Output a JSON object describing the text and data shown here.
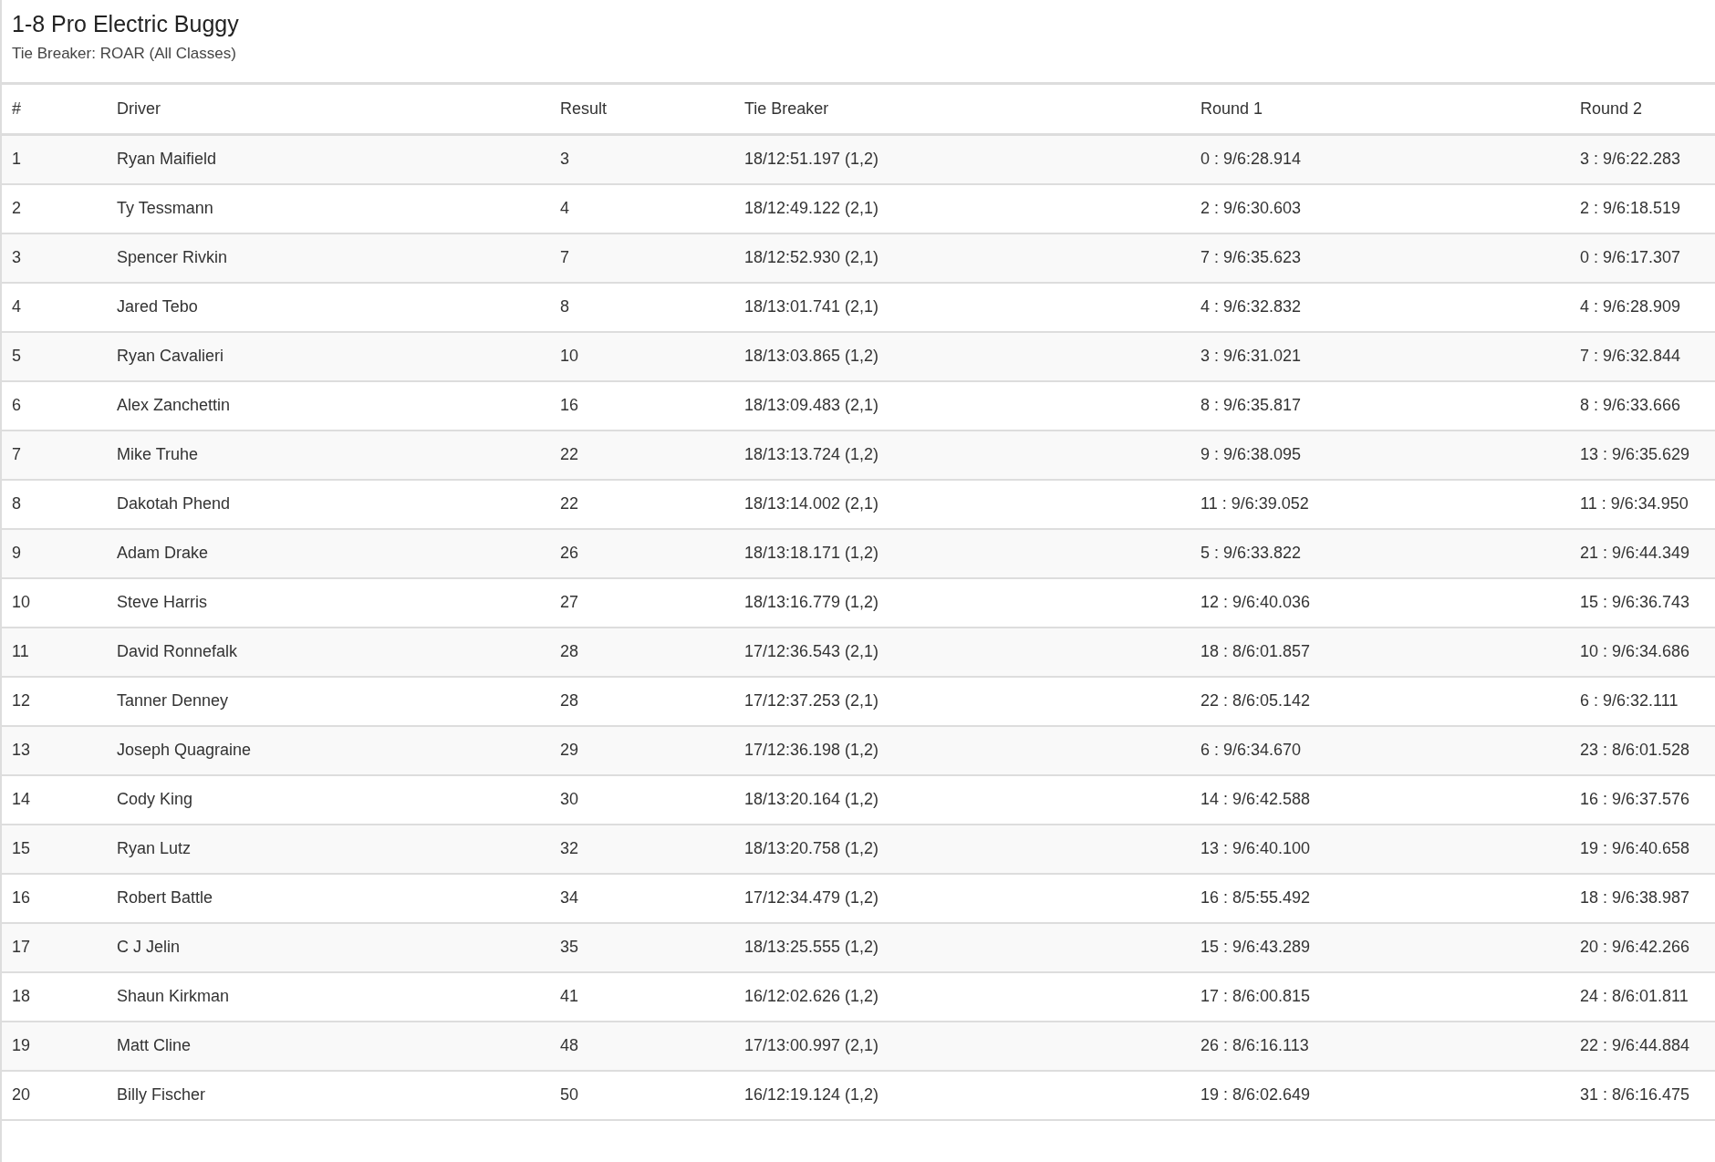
{
  "heading": {
    "title": "1-8 Pro Electric Buggy",
    "subtitle": "Tie Breaker: ROAR (All Classes)"
  },
  "table": {
    "columns": [
      "#",
      "Driver",
      "Result",
      "Tie Breaker",
      "Round 1",
      "Round 2"
    ],
    "rows": [
      [
        "1",
        "Ryan Maifield",
        "3",
        "18/12:51.197 (1,2)",
        "0 : 9/6:28.914",
        "3 : 9/6:22.283"
      ],
      [
        "2",
        "Ty Tessmann",
        "4",
        "18/12:49.122 (2,1)",
        "2 : 9/6:30.603",
        "2 : 9/6:18.519"
      ],
      [
        "3",
        "Spencer Rivkin",
        "7",
        "18/12:52.930 (2,1)",
        "7 : 9/6:35.623",
        "0 : 9/6:17.307"
      ],
      [
        "4",
        "Jared Tebo",
        "8",
        "18/13:01.741 (2,1)",
        "4 : 9/6:32.832",
        "4 : 9/6:28.909"
      ],
      [
        "5",
        "Ryan Cavalieri",
        "10",
        "18/13:03.865 (1,2)",
        "3 : 9/6:31.021",
        "7 : 9/6:32.844"
      ],
      [
        "6",
        "Alex Zanchettin",
        "16",
        "18/13:09.483 (2,1)",
        "8 : 9/6:35.817",
        "8 : 9/6:33.666"
      ],
      [
        "7",
        "Mike Truhe",
        "22",
        "18/13:13.724 (1,2)",
        "9 : 9/6:38.095",
        "13 : 9/6:35.629"
      ],
      [
        "8",
        "Dakotah Phend",
        "22",
        "18/13:14.002 (2,1)",
        "11 : 9/6:39.052",
        "11 : 9/6:34.950"
      ],
      [
        "9",
        "Adam Drake",
        "26",
        "18/13:18.171 (1,2)",
        "5 : 9/6:33.822",
        "21 : 9/6:44.349"
      ],
      [
        "10",
        "Steve Harris",
        "27",
        "18/13:16.779 (1,2)",
        "12 : 9/6:40.036",
        "15 : 9/6:36.743"
      ],
      [
        "11",
        "David Ronnefalk",
        "28",
        "17/12:36.543 (2,1)",
        "18 : 8/6:01.857",
        "10 : 9/6:34.686"
      ],
      [
        "12",
        "Tanner Denney",
        "28",
        "17/12:37.253 (2,1)",
        "22 : 8/6:05.142",
        "6 : 9/6:32.111"
      ],
      [
        "13",
        "Joseph Quagraine",
        "29",
        "17/12:36.198 (1,2)",
        "6 : 9/6:34.670",
        "23 : 8/6:01.528"
      ],
      [
        "14",
        "Cody King",
        "30",
        "18/13:20.164 (1,2)",
        "14 : 9/6:42.588",
        "16 : 9/6:37.576"
      ],
      [
        "15",
        "Ryan Lutz",
        "32",
        "18/13:20.758 (1,2)",
        "13 : 9/6:40.100",
        "19 : 9/6:40.658"
      ],
      [
        "16",
        "Robert Battle",
        "34",
        "17/12:34.479 (1,2)",
        "16 : 8/5:55.492",
        "18 : 9/6:38.987"
      ],
      [
        "17",
        "C J Jelin",
        "35",
        "18/13:25.555 (1,2)",
        "15 : 9/6:43.289",
        "20 : 9/6:42.266"
      ],
      [
        "18",
        "Shaun Kirkman",
        "41",
        "16/12:02.626 (1,2)",
        "17 : 8/6:00.815",
        "24 : 8/6:01.811"
      ],
      [
        "19",
        "Matt Cline",
        "48",
        "17/13:00.997 (2,1)",
        "26 : 8/6:16.113",
        "22 : 9/6:44.884"
      ],
      [
        "20",
        "Billy Fischer",
        "50",
        "16/12:19.124 (1,2)",
        "19 : 8/6:02.649",
        "31 : 8/6:16.475"
      ]
    ]
  }
}
